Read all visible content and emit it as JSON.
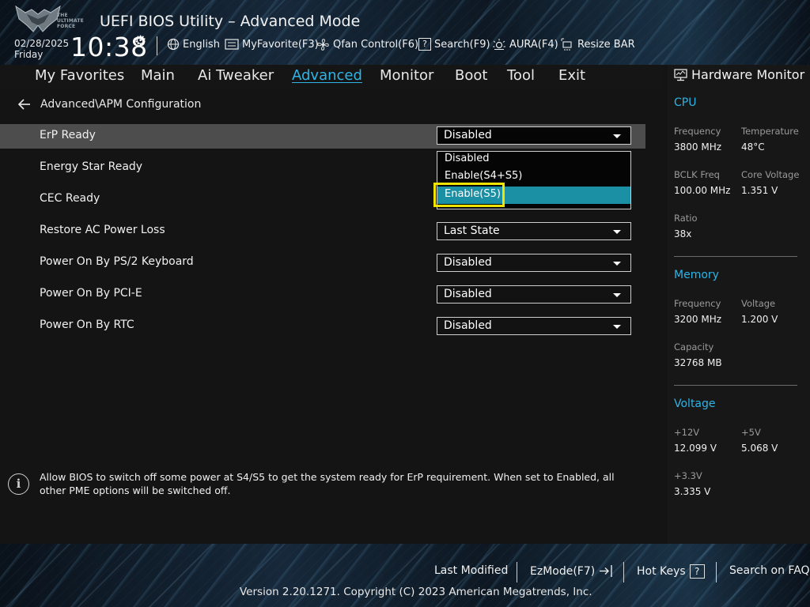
{
  "header": {
    "logo_text_lines": [
      "THE",
      "ULTIMATE",
      "FORCE"
    ],
    "app_title": "UEFI BIOS Utility – Advanced Mode",
    "date": "02/28/2025",
    "day": "Friday",
    "time": "10:38",
    "tools": [
      {
        "icon": "globe-icon",
        "label": "English"
      },
      {
        "icon": "favorite-icon",
        "label": "MyFavorite(F3)"
      },
      {
        "icon": "fan-icon",
        "label": "Qfan Control(F6)"
      },
      {
        "icon": "search-help-icon",
        "label": "Search(F9)"
      },
      {
        "icon": "aura-icon",
        "label": "AURA(F4)"
      },
      {
        "icon": "resize-bar-icon",
        "label": "Resize BAR"
      }
    ]
  },
  "menu": {
    "items": [
      "My Favorites",
      "Main",
      "Ai Tweaker",
      "Advanced",
      "Monitor",
      "Boot",
      "Tool",
      "Exit"
    ],
    "active": "Advanced"
  },
  "breadcrumb": "Advanced\\APM Configuration",
  "settings": [
    {
      "label": "ErP Ready",
      "value": "Disabled"
    },
    {
      "label": "Energy Star Ready",
      "value": ""
    },
    {
      "label": "CEC Ready",
      "value": ""
    },
    {
      "label": "Restore AC Power Loss",
      "value": "Last State"
    },
    {
      "label": "Power On By PS/2 Keyboard",
      "value": "Disabled"
    },
    {
      "label": "Power On By PCI-E",
      "value": "Disabled"
    },
    {
      "label": "Power On By RTC",
      "value": "Disabled"
    }
  ],
  "dropdown": {
    "options": [
      "Disabled",
      "Enable(S4+S5)",
      "Enable(S5)"
    ],
    "selected": "Enable(S5)"
  },
  "help_text": "Allow BIOS to switch off some power at S4/S5 to get the system ready for ErP requirement. When set to Enabled, all other PME options will be switched off.",
  "hardware_monitor": {
    "title": "Hardware Monitor",
    "cpu": {
      "title": "CPU",
      "frequency_label": "Frequency",
      "frequency": "3800 MHz",
      "temperature_label": "Temperature",
      "temperature": "48°C",
      "bclk_label": "BCLK Freq",
      "bclk": "100.00 MHz",
      "core_voltage_label": "Core Voltage",
      "core_voltage": "1.351 V",
      "ratio_label": "Ratio",
      "ratio": "38x"
    },
    "memory": {
      "title": "Memory",
      "frequency_label": "Frequency",
      "frequency": "3200 MHz",
      "voltage_label": "Voltage",
      "voltage": "1.200 V",
      "capacity_label": "Capacity",
      "capacity": "32768 MB"
    },
    "voltage": {
      "title": "Voltage",
      "v12_label": "+12V",
      "v12": "12.099 V",
      "v5_label": "+5V",
      "v5": "5.068 V",
      "v33_label": "+3.3V",
      "v33": "3.335 V"
    }
  },
  "footer": {
    "last_modified": "Last Modified",
    "ezmode": "EzMode(F7)",
    "hot_keys": "Hot Keys",
    "hot_keys_glyph": "?",
    "search_faq": "Search on FAQ",
    "copyright": "Version 2.20.1271. Copyright (C) 2023 American Megatrends, Inc."
  },
  "colors": {
    "accent": "#2eb4e6",
    "selected_option": "#1b8fa3",
    "highlight_box": "#f1e400",
    "row_highlight": "#4d4d4d"
  }
}
